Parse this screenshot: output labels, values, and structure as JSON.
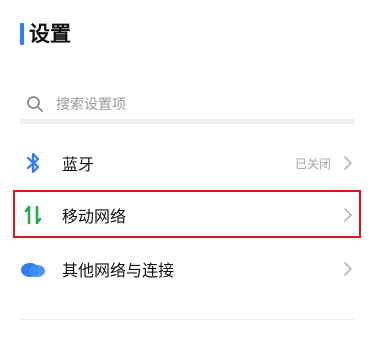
{
  "header": {
    "title": "设置"
  },
  "search": {
    "placeholder": "搜索设置项",
    "icon": "search-icon"
  },
  "items": [
    {
      "label": "蓝牙",
      "value": "已关闭",
      "icon": "bluetooth-icon"
    },
    {
      "label": "移动网络",
      "value": "",
      "icon": "mobile-network-icon"
    },
    {
      "label": "其他网络与连接",
      "value": "",
      "icon": "connections-icon"
    }
  ],
  "colors": {
    "accent": "#2f7cf6",
    "highlight_border": "#e2141d",
    "mobile_network_green": "#2ea84c"
  }
}
